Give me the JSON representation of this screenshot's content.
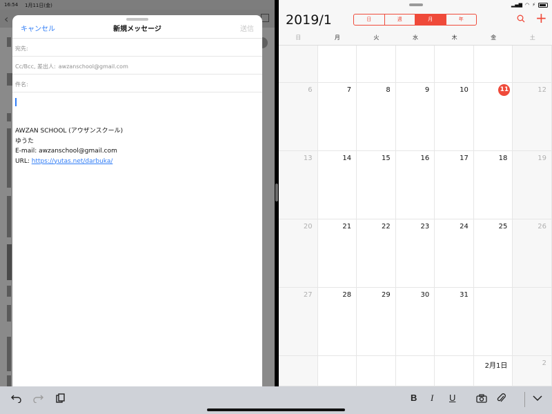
{
  "status_bar": {
    "time": "16:54",
    "date": "1月11日(金)"
  },
  "compose": {
    "cancel": "キャンセル",
    "title": "新規メッセージ",
    "send": "送信",
    "to_label": "宛先:",
    "cc_label": "Cc/Bcc, 差出人:",
    "cc_value": "awzanschool@gmail.com",
    "subject_label": "件名:",
    "signature": {
      "line1": "AWZAN SCHOOL (アウザンスクール)",
      "line2": "ゆうた",
      "line3": "E-mail: awzanschool@gmail.com",
      "url_label": "URL: ",
      "url": "https://yutas.net/darbuka/"
    }
  },
  "calendar": {
    "title": "2019/1",
    "view_tabs": [
      "日",
      "週",
      "月",
      "年"
    ],
    "active_tab": "月",
    "weekdays": [
      "日",
      "月",
      "火",
      "水",
      "木",
      "金",
      "土"
    ],
    "weeks": [
      [
        "",
        "",
        "",
        "",
        "",
        "",
        ""
      ],
      [
        "6",
        "7",
        "8",
        "9",
        "10",
        "11",
        "12"
      ],
      [
        "13",
        "14",
        "15",
        "16",
        "17",
        "18",
        "19"
      ],
      [
        "20",
        "21",
        "22",
        "23",
        "24",
        "25",
        "26"
      ],
      [
        "27",
        "28",
        "29",
        "30",
        "31",
        "",
        ""
      ],
      [
        "",
        "",
        "",
        "",
        "",
        "2月1日",
        "2"
      ]
    ],
    "today": "11",
    "accent_color": "#ef4a3a"
  },
  "toolbar": {
    "undo_icon": "undo-icon",
    "redo_icon": "redo-icon",
    "clipboard_icon": "clipboard-icon",
    "bold": "B",
    "italic": "I",
    "underline": "U",
    "camera_icon": "camera-icon",
    "attach_icon": "paperclip-icon",
    "dismiss_icon": "chevron-down-icon"
  }
}
